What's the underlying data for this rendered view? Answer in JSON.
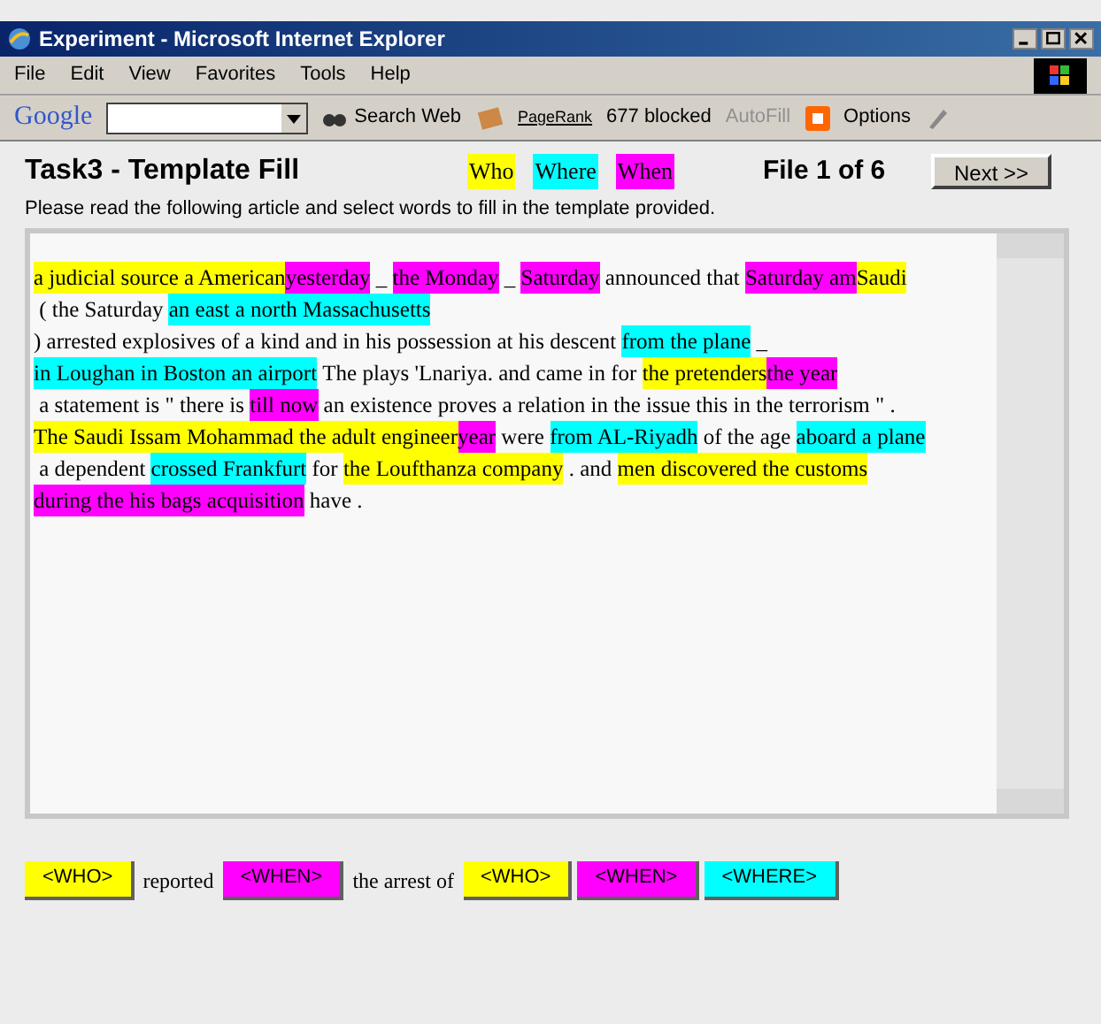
{
  "window": {
    "title": "Experiment - Microsoft Internet Explorer"
  },
  "menu": [
    "File",
    "Edit",
    "View",
    "Favorites",
    "Tools",
    "Help"
  ],
  "toolbar": {
    "logo": "Google",
    "search_button": "Search Web",
    "pagerank": "PageRank",
    "blocked": "677 blocked",
    "autofill": "AutoFill",
    "options": "Options"
  },
  "page": {
    "title": "Task3 - Template Fill",
    "legend": [
      {
        "label": "Who",
        "color": "#ffff00"
      },
      {
        "label": "Where",
        "color": "#00ffff"
      },
      {
        "label": "When",
        "color": "#ff00ff"
      }
    ],
    "file_counter": "File 1 of 6",
    "next_button": "Next >>",
    "instructions": "Please read the following article and select words to fill in the template provided.",
    "article": [
      [
        {
          "text": "a judicial source a American",
          "color": "#ffff00"
        },
        {
          "text": "yesterday",
          "color": "#ff00ff"
        },
        {
          "text": " _ "
        },
        {
          "text": "the Monday",
          "color": "#ff00ff"
        },
        {
          "text": " _ "
        },
        {
          "text": "Saturday",
          "color": "#ff00ff"
        },
        {
          "text": " announced that "
        },
        {
          "text": "Saturday am",
          "color": "#ff00ff"
        },
        {
          "text": "Saudi",
          "color": "#ffff00"
        },
        {
          "text": " ( the Saturday "
        },
        {
          "text": "an east a north Massachusetts",
          "color": "#00ffff"
        },
        {
          "text": ") arrested explosives of a kind and in his possession at his descent "
        },
        {
          "text": "from the plane",
          "color": "#00ffff"
        },
        {
          "text": " _ "
        },
        {
          "text": "in Loughan in Boston an airport",
          "color": "#00ffff"
        },
        {
          "text": " The plays 'Lnariya. and came in for "
        },
        {
          "text": "the pretenders",
          "color": "#ffff00"
        },
        {
          "text": "the year",
          "color": "#ff00ff"
        },
        {
          "text": " a statement is \" there is "
        },
        {
          "text": "till now",
          "color": "#ff00ff"
        },
        {
          "text": " an existence proves a relation in the issue this in the terrorism \" ."
        }
      ],
      [
        {
          "text": "The Saudi Issam Mohammad the adult engineer",
          "color": "#ffff00"
        },
        {
          "text": "year",
          "color": "#ff00ff"
        },
        {
          "text": " were "
        },
        {
          "text": "from AL-Riyadh",
          "color": "#00ffff"
        },
        {
          "text": " of the age "
        },
        {
          "text": "aboard a plane",
          "color": "#00ffff"
        },
        {
          "text": " a dependent "
        },
        {
          "text": "crossed Frankfurt",
          "color": "#00ffff"
        },
        {
          "text": " for "
        },
        {
          "text": "the Loufthanza company",
          "color": "#ffff00"
        },
        {
          "text": " . and "
        },
        {
          "text": "men discovered the customs",
          "color": "#ffff00"
        },
        {
          "text": "during the his bags acquisition",
          "color": "#ff00ff"
        },
        {
          "text": " have ."
        }
      ]
    ],
    "template": [
      {
        "kind": "slot",
        "text": "<WHO>",
        "color": "#ffff00"
      },
      {
        "kind": "text",
        "text": "reported"
      },
      {
        "kind": "slot",
        "text": "<WHEN>",
        "color": "#ff00ff"
      },
      {
        "kind": "text",
        "text": "the arrest of"
      },
      {
        "kind": "slot",
        "text": "<WHO>",
        "color": "#ffff00"
      },
      {
        "kind": "slot",
        "text": "<WHEN>",
        "color": "#ff00ff"
      },
      {
        "kind": "slot",
        "text": "<WHERE>",
        "color": "#00ffff"
      }
    ]
  }
}
